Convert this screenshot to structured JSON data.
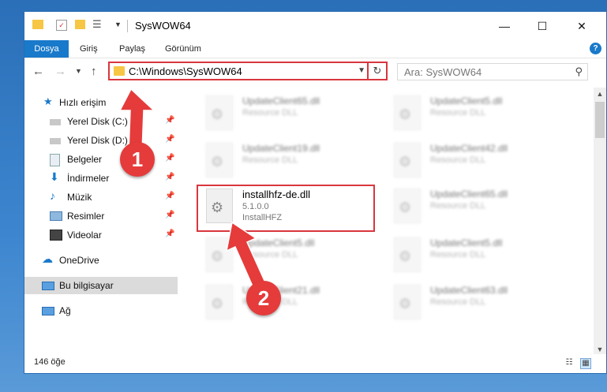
{
  "window": {
    "title": "SysWOW64",
    "status": "146 öğe"
  },
  "ribbon": {
    "tabs": [
      "Dosya",
      "Giriş",
      "Paylaş",
      "Görünüm"
    ],
    "help": "?"
  },
  "address": {
    "path": "C:\\Windows\\SysWOW64",
    "search_placeholder": "Ara: SysWOW64"
  },
  "sidebar": {
    "items": [
      {
        "label": "Hızlı erişim",
        "icon": "star-icon",
        "pinned": false
      },
      {
        "label": "Yerel Disk (C:)",
        "icon": "drive-icon",
        "pinned": true
      },
      {
        "label": "Yerel Disk (D:)",
        "icon": "drive-icon",
        "pinned": true
      },
      {
        "label": "Belgeler",
        "icon": "documents-icon",
        "pinned": true
      },
      {
        "label": "İndirmeler",
        "icon": "download-icon",
        "pinned": true
      },
      {
        "label": "Müzik",
        "icon": "music-icon",
        "pinned": true
      },
      {
        "label": "Resimler",
        "icon": "pictures-icon",
        "pinned": true
      },
      {
        "label": "Videolar",
        "icon": "videos-icon",
        "pinned": true
      },
      {
        "label": "OneDrive",
        "icon": "cloud-icon",
        "pinned": false
      },
      {
        "label": "Bu bilgisayar",
        "icon": "computer-icon",
        "pinned": false
      },
      {
        "label": "Ağ",
        "icon": "network-icon",
        "pinned": false
      }
    ]
  },
  "files": [
    {
      "name": "UpdateClient65.dll",
      "sub1": "Resource DLL"
    },
    {
      "name": "UpdateClient5.dll",
      "sub1": "Resource DLL"
    },
    {
      "name": "UpdateClient19.dll",
      "sub1": "Resource DLL"
    },
    {
      "name": "UpdateClient42.dll",
      "sub1": "Resource DLL"
    },
    {
      "name": "installhfz-de.dll",
      "sub1": "5.1.0.0",
      "sub2": "InstallHFZ"
    },
    {
      "name": "UpdateClient65.dll",
      "sub1": "Resource DLL"
    },
    {
      "name": "UpdateClient5.dll",
      "sub1": "Resource DLL"
    },
    {
      "name": "UpdateClient5.dll",
      "sub1": "Resource DLL"
    },
    {
      "name": "UpdateClient21.dll",
      "sub1": "Resource DLL"
    },
    {
      "name": "UpdateClient63.dll",
      "sub1": "Resource DLL"
    }
  ],
  "annotations": {
    "step1": "1",
    "step2": "2"
  },
  "colors": {
    "accent": "#1979ca",
    "highlight": "#d9363e",
    "selected": "#dbdbdb"
  }
}
